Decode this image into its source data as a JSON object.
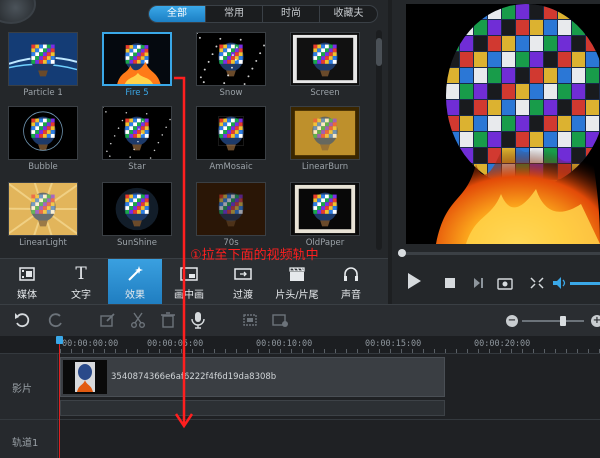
{
  "filter_tabs": [
    {
      "label": "全部",
      "active": true
    },
    {
      "label": "常用",
      "active": false
    },
    {
      "label": "时尚",
      "active": false
    },
    {
      "label": "收藏夫",
      "active": false
    }
  ],
  "effects": [
    {
      "label": "Particle 1",
      "style": "particle",
      "selected": false
    },
    {
      "label": "Fire 5",
      "style": "fire",
      "selected": true
    },
    {
      "label": "Snow",
      "style": "snow",
      "selected": false
    },
    {
      "label": "Screen",
      "style": "screen",
      "selected": false
    },
    {
      "label": "Bubble",
      "style": "bubble",
      "selected": false
    },
    {
      "label": "Star",
      "style": "star",
      "selected": false
    },
    {
      "label": "AmMosaic",
      "style": "mosaic",
      "selected": false
    },
    {
      "label": "LinearBurn",
      "style": "burn",
      "selected": false
    },
    {
      "label": "LinearLight",
      "style": "light",
      "selected": false
    },
    {
      "label": "SunShine",
      "style": "sunshine",
      "selected": false
    },
    {
      "label": "70s",
      "style": "seventies",
      "selected": false
    },
    {
      "label": "OldPaper",
      "style": "oldpaper",
      "selected": false
    }
  ],
  "categories": [
    {
      "label": "媒体",
      "icon": "film-icon",
      "active": false
    },
    {
      "label": "文字",
      "icon": "text-icon",
      "active": false
    },
    {
      "label": "效果",
      "icon": "magic-wand-icon",
      "active": true
    },
    {
      "label": "画中画",
      "icon": "picture-in-picture-icon",
      "active": false
    },
    {
      "label": "过渡",
      "icon": "transition-icon",
      "active": false
    },
    {
      "label": "片头/片尾",
      "icon": "clapperboard-icon",
      "active": false
    },
    {
      "label": "声音",
      "icon": "headphones-icon",
      "active": false
    }
  ],
  "ruler": {
    "labels": [
      "00:00:00:00",
      "00:00:05:00",
      "00:00:10:00",
      "00:00:15:00",
      "00:00:20:00"
    ]
  },
  "tracks": {
    "video_label": "影片",
    "track1_label": "轨道1",
    "clip_name": "3540874366e6af6222f4f6d19da8308b"
  },
  "annotation": {
    "text": "①拉至下面的视频轨中",
    "color": "#ff1f1f"
  },
  "colors": {
    "accent": "#3aa8e8",
    "playhead": "#e02020"
  }
}
